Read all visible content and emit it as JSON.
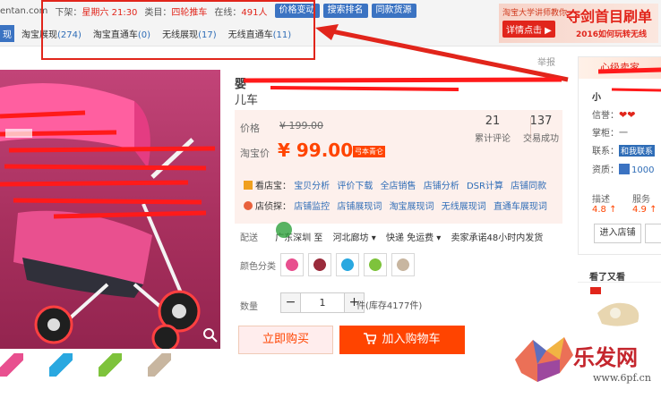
{
  "plugin_bar": {
    "row1": [
      {
        "label": "entan.com",
        "value": ""
      },
      {
        "label": "下架：",
        "value": "星期六 21:30"
      },
      {
        "label": "类目：",
        "value": "四轮推车"
      },
      {
        "label": "在线：",
        "value": "491人"
      }
    ],
    "buttons": [
      "价格变动",
      "搜索排名",
      "同款货源"
    ],
    "tab_start": "现",
    "tabs": [
      {
        "label": "淘宝展现",
        "count": "(274)"
      },
      {
        "label": "淘宝直通车",
        "count": "(0)"
      },
      {
        "label": "无线展现",
        "count": "(17)"
      },
      {
        "label": "无线直通车",
        "count": "(11)"
      }
    ]
  },
  "banner": {
    "line1": "淘宝大学讲师教你",
    "headline": "夺剑首目刷单",
    "button": "详情点击 ▶",
    "line2": "2016如何玩转无线"
  },
  "product": {
    "title_line1": "婴",
    "title_line2": "儿车",
    "report": "举报",
    "price_label": "价格",
    "price_original": "¥ 199.00",
    "taobao_price_label": "淘宝价",
    "price_sale": "¥ 99.00",
    "cert_badge": "弓本青仑",
    "reviews_count": "21",
    "reviews_label": "累计评论",
    "sales_count": "137",
    "sales_label": "交易成功",
    "kandianbao_label": "看店宝：",
    "kandianbao_links": [
      "宝贝分析",
      "评价下载",
      "全店销售",
      "店铺分析",
      "DSR计算",
      "店铺同款"
    ],
    "dianxiaxia_label": "店侦探：",
    "dianxiaxia_links": [
      "店铺监控",
      "店铺展现词",
      "淘宝展现词",
      "无线展现词",
      "直通车展现词"
    ],
    "shipping_label": "配送",
    "shipping_from": "广东深圳 至",
    "shipping_to": "河北廊坊 ▾",
    "shipping_method": "快递 免运费 ▾",
    "shipping_promise": "卖家承诺48小时内发货",
    "color_label": "颜色分类",
    "quantity_label": "数量",
    "quantity_value": "1",
    "quantity_minus": "−",
    "quantity_plus": "+",
    "stock": "件(库存4177件)",
    "buy_now": "立即购买",
    "add_to_cart": "加入购物车"
  },
  "shop": {
    "header": "心级卖家",
    "name": "小",
    "reputation_label": "信誉：",
    "hearts": "❤❤",
    "counter_label": "掌柜：",
    "counter_value": "一",
    "contact_label": "联系：",
    "contact_badge": "和我联系",
    "qualification_label": "资质：",
    "qualification_value": "1000",
    "desc_label": "描述",
    "desc_value": "4.8 ↑",
    "service_label": "服务",
    "service_value": "4.9 ↑",
    "enter_shop": "进入店铺"
  },
  "also_viewed": "看了又看",
  "watermark": {
    "brand": "乐发网",
    "url": "www.6pf.cn"
  },
  "colors": {
    "accent_red": "#e1251b",
    "taobao_orange": "#ff4400",
    "link_blue": "#2f6db7",
    "plugin_blue": "#3b73c2"
  }
}
